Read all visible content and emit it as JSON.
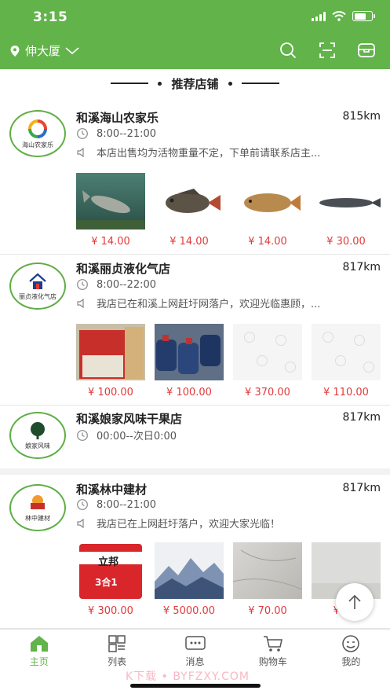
{
  "status_bar": {
    "time": "3:15"
  },
  "header": {
    "location": "伸大厦",
    "colors": {
      "brand": "#61b34a"
    },
    "icons": [
      "location-pin-icon",
      "chevron-down-icon",
      "search-icon",
      "scan-icon",
      "message-box-icon"
    ]
  },
  "section": {
    "title": "推荐店铺"
  },
  "stores": [
    {
      "name": "和溪海山农家乐",
      "distance": "815km",
      "hours": "8:00--21:00",
      "notice": "本店出售均为活物重量不定，下单前请联系店主...",
      "logo_caption": "海山农家乐",
      "products": [
        {
          "price": "¥ 14.00",
          "image": "fish-in-water"
        },
        {
          "price": "¥ 14.00",
          "image": "tilapia-fish"
        },
        {
          "price": "¥ 14.00",
          "image": "carp-fish"
        },
        {
          "price": "¥ 30.00",
          "image": "catfish"
        }
      ]
    },
    {
      "name": "和溪丽贞液化气店",
      "distance": "817km",
      "hours": "8:00--22:00",
      "notice": "我店已在和溪上网赶圩网落户，欢迎光临惠顾，...",
      "logo_caption": "丽贞液化气店",
      "products": [
        {
          "price": "¥ 100.00",
          "image": "gift-box"
        },
        {
          "price": "¥ 100.00",
          "image": "gas-cylinders"
        },
        {
          "price": "¥ 370.00",
          "image": "placeholder"
        },
        {
          "price": "¥ 110.00",
          "image": "placeholder"
        }
      ]
    },
    {
      "name": "和溪娘家风味干果店",
      "distance": "817km",
      "hours": "00:00--次日0:00",
      "logo_caption": "娘家风味"
    },
    {
      "name": "和溪林中建材",
      "distance": "817km",
      "hours": "8:00--21:00",
      "notice": "我店已在上网赶圩落户，欢迎大家光临！",
      "logo_caption": "林中建材",
      "products": [
        {
          "price": "¥ 300.00",
          "image": "paint-bucket",
          "brand_text": "立邦",
          "label_text": "3合1"
        },
        {
          "price": "¥ 5000.00",
          "image": "ink-landscape-tile"
        },
        {
          "price": "¥ 70.00",
          "image": "marble-tile"
        },
        {
          "price": "¥ 1...",
          "image": "wall-decor"
        }
      ]
    }
  ],
  "tabbar": {
    "items": [
      {
        "label": "主页",
        "icon": "home-icon",
        "active": true
      },
      {
        "label": "列表",
        "icon": "list-grid-icon",
        "active": false
      },
      {
        "label": "消息",
        "icon": "message-icon",
        "active": false
      },
      {
        "label": "购物车",
        "icon": "cart-icon",
        "active": false
      },
      {
        "label": "我的",
        "icon": "profile-icon",
        "active": false
      }
    ]
  },
  "watermark": "K下载 • BYFZXY.COM"
}
